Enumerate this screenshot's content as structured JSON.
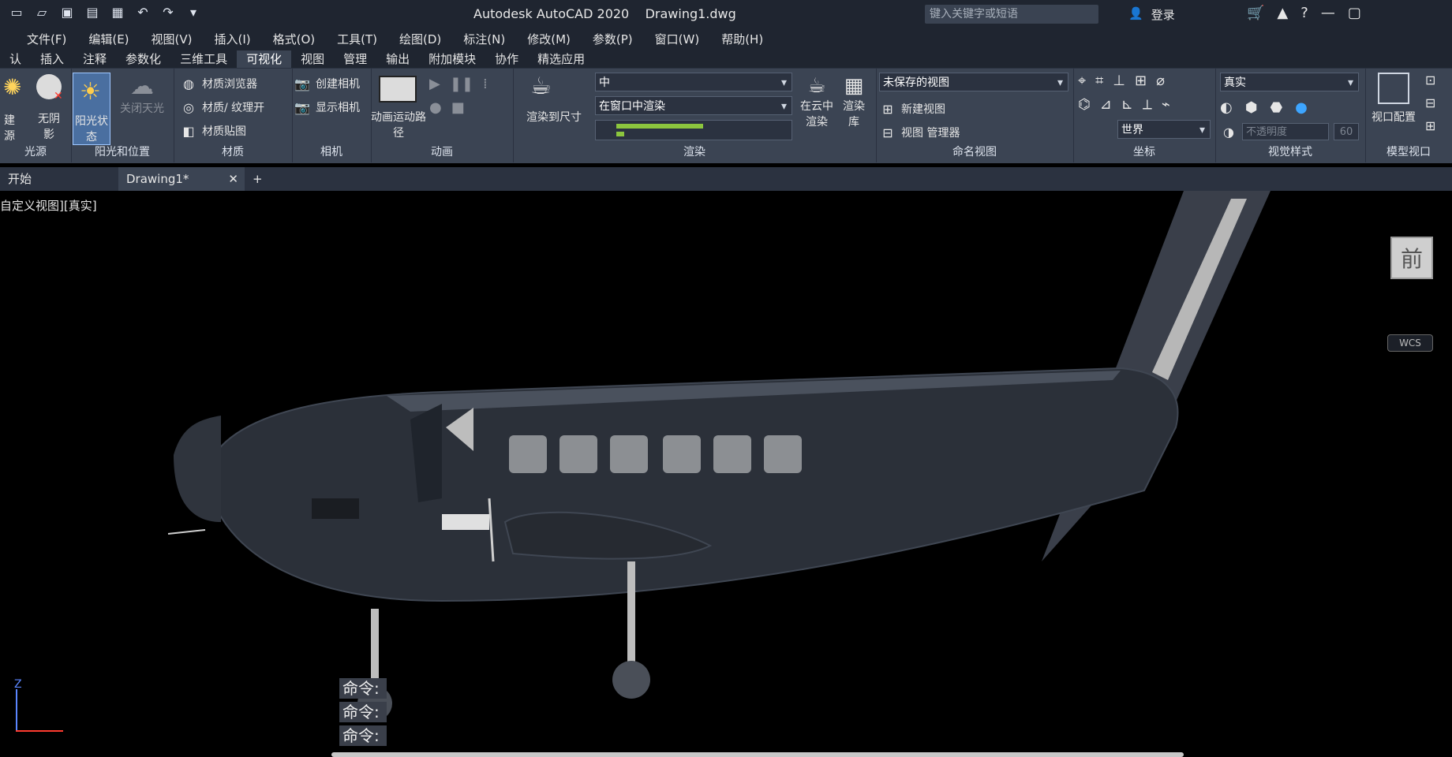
{
  "title": {
    "app": "Autodesk AutoCAD 2020",
    "file": "Drawing1.dwg"
  },
  "search": {
    "placeholder": "键入关键字或短语"
  },
  "login": "登录",
  "menu": [
    "文件(F)",
    "编辑(E)",
    "视图(V)",
    "插入(I)",
    "格式(O)",
    "工具(T)",
    "绘图(D)",
    "标注(N)",
    "修改(M)",
    "参数(P)",
    "窗口(W)",
    "帮助(H)"
  ],
  "ribbon_tabs": [
    "认",
    "插入",
    "注释",
    "参数化",
    "三维工具",
    "可视化",
    "视图",
    "管理",
    "输出",
    "附加模块",
    "协作",
    "精选应用"
  ],
  "ribbon_active": "可视化",
  "groups": {
    "lights": {
      "title": "光源",
      "buttons": [
        "建",
        "源"
      ]
    },
    "sun": {
      "title": "阳光和位置",
      "buttons": [
        "无阴影",
        "阳光状态",
        "关闭天光"
      ]
    },
    "materials": {
      "title": "材质",
      "items": [
        "材质浏览器",
        "材质/ 纹理开",
        "材质贴图"
      ]
    },
    "camera": {
      "title": "相机",
      "items": [
        "创建相机",
        "显示相机"
      ]
    },
    "animation": {
      "title": "动画",
      "label": "动画运动路径"
    },
    "render": {
      "title": "渲染",
      "render_size": "渲染到尺寸",
      "quality": "中",
      "output": "在窗口中渲染",
      "cloud": "在云中渲染",
      "library": "渲染库"
    },
    "named_views": {
      "title": "命名视图",
      "current": "未保存的视图",
      "new_view": "新建视图",
      "manager": "视图 管理器"
    },
    "coords": {
      "title": "坐标",
      "ucs": "世界"
    },
    "visual_styles": {
      "title": "视觉样式",
      "style": "真实",
      "opacity_placeholder": "不透明度",
      "opacity_value": "60"
    },
    "model_viewport": {
      "title": "模型视口",
      "label": "视口配置"
    }
  },
  "file_tabs": [
    "开始",
    "Drawing1*"
  ],
  "viewport": {
    "label": "自定义视图][真实]",
    "viewcube": "前",
    "wcs": "WCS"
  },
  "command_lines": [
    "命令:",
    "命令:",
    "命令:"
  ]
}
